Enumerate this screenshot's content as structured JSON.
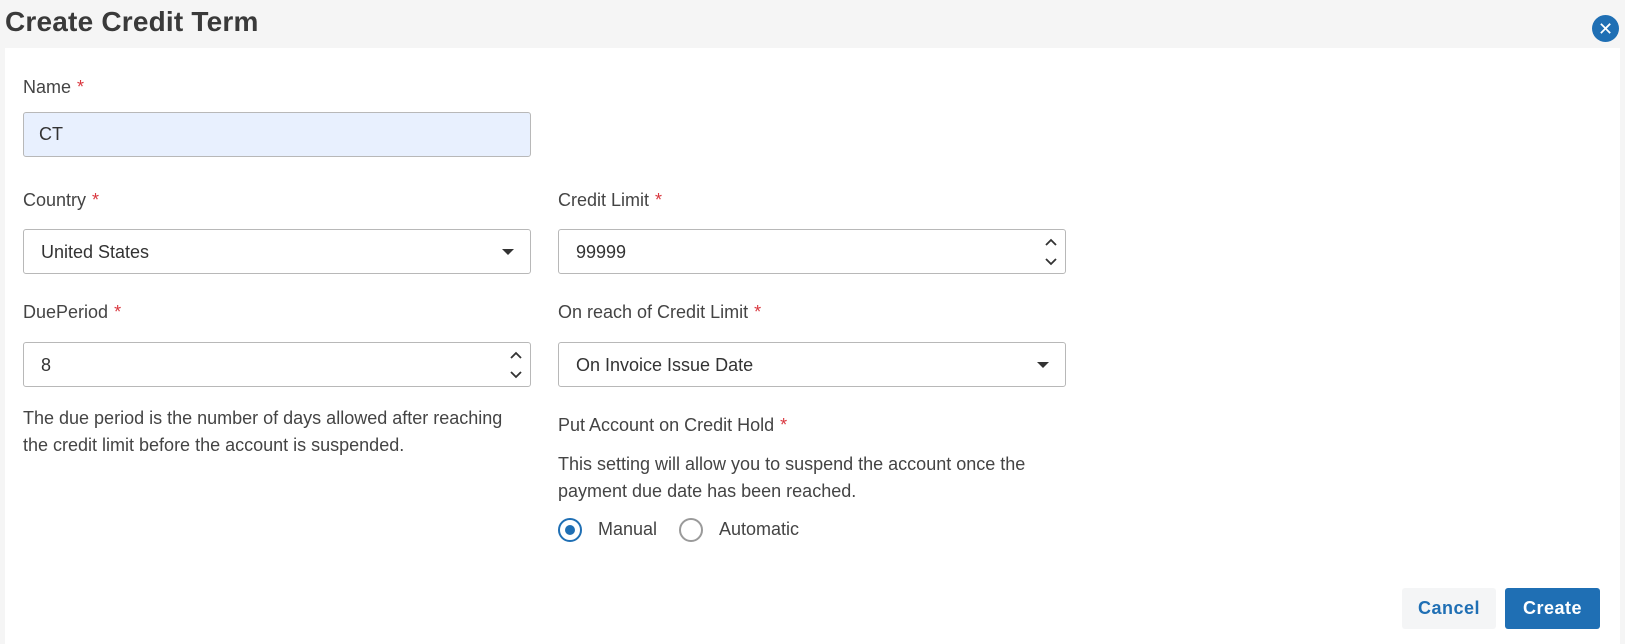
{
  "dialog": {
    "title": "Create Credit Term",
    "close_icon": "close-icon"
  },
  "form": {
    "name": {
      "label": "Name",
      "required_mark": "*",
      "value": "CT"
    },
    "country": {
      "label": "Country",
      "required_mark": "*",
      "value": "United States"
    },
    "credit_limit": {
      "label": "Credit Limit",
      "required_mark": "*",
      "value": "99999"
    },
    "due_period": {
      "label": "DuePeriod",
      "required_mark": "*",
      "value": "8",
      "help_line1": "The due period is the number of days allowed after reaching",
      "help_line2": "the credit limit before the account is suspended."
    },
    "on_reach": {
      "label": "On reach of Credit Limit",
      "required_mark": "*",
      "value": "On Invoice Issue Date"
    },
    "credit_hold": {
      "label": "Put Account on Credit Hold",
      "required_mark": "*",
      "help_line1": "This setting will allow you to suspend the account once the",
      "help_line2": "payment due date has been reached.",
      "options": [
        {
          "label": "Manual",
          "selected": true
        },
        {
          "label": "Automatic",
          "selected": false
        }
      ]
    }
  },
  "actions": {
    "cancel_label": "Cancel",
    "create_label": "Create"
  },
  "colors": {
    "accent": "#1f6fb4",
    "required": "#d9363e",
    "autofill_bg": "#e8f0fe"
  }
}
